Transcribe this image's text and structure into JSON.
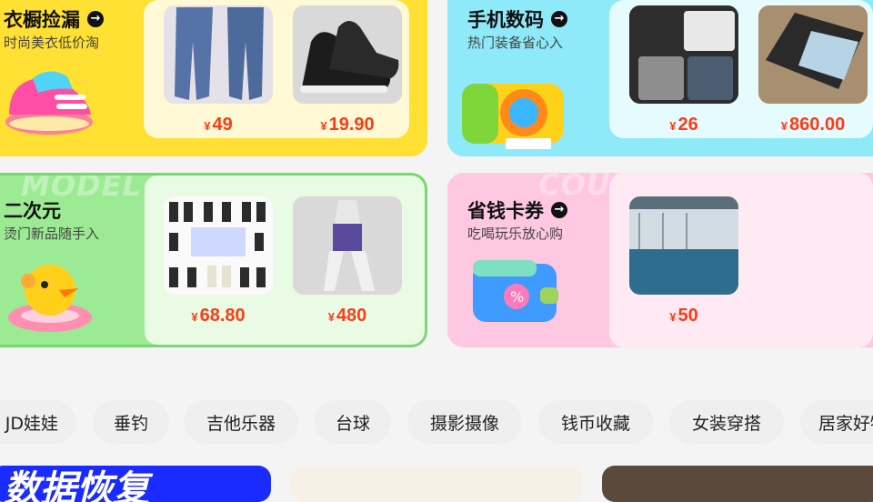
{
  "cards": [
    {
      "title": "衣橱捡漏",
      "subtitle": "时尚美衣低价淘",
      "watermark": "",
      "products": [
        {
          "price": "49"
        },
        {
          "price": "19.90"
        }
      ]
    },
    {
      "title": "手机数码",
      "subtitle": "热门装备省心入",
      "watermark": "",
      "products": [
        {
          "price": "26"
        },
        {
          "price": "860.00"
        }
      ]
    },
    {
      "title": "二次元",
      "subtitle": "烫门新品随手入",
      "watermark": "MODEL",
      "products": [
        {
          "price": "68.80"
        },
        {
          "price": "480"
        }
      ]
    },
    {
      "title": "省钱卡券",
      "subtitle": "吃喝玩乐放心购",
      "watermark": "COUPON",
      "products": [
        {
          "price": "50"
        }
      ]
    }
  ],
  "currency": "¥",
  "arrow_icon": "→",
  "chips": [
    "JD娃娃",
    "垂钓",
    "吉他乐器",
    "台球",
    "摄影摄像",
    "钱币收藏",
    "女装穿搭",
    "居家好物"
  ],
  "bottom_banner_text": "数据恢复",
  "colors": {
    "yellow": "#ffe033",
    "cyan": "#8eeaf9",
    "green": "#9ceb94",
    "pink": "#ffc8e2",
    "price": "#ff3b14"
  }
}
